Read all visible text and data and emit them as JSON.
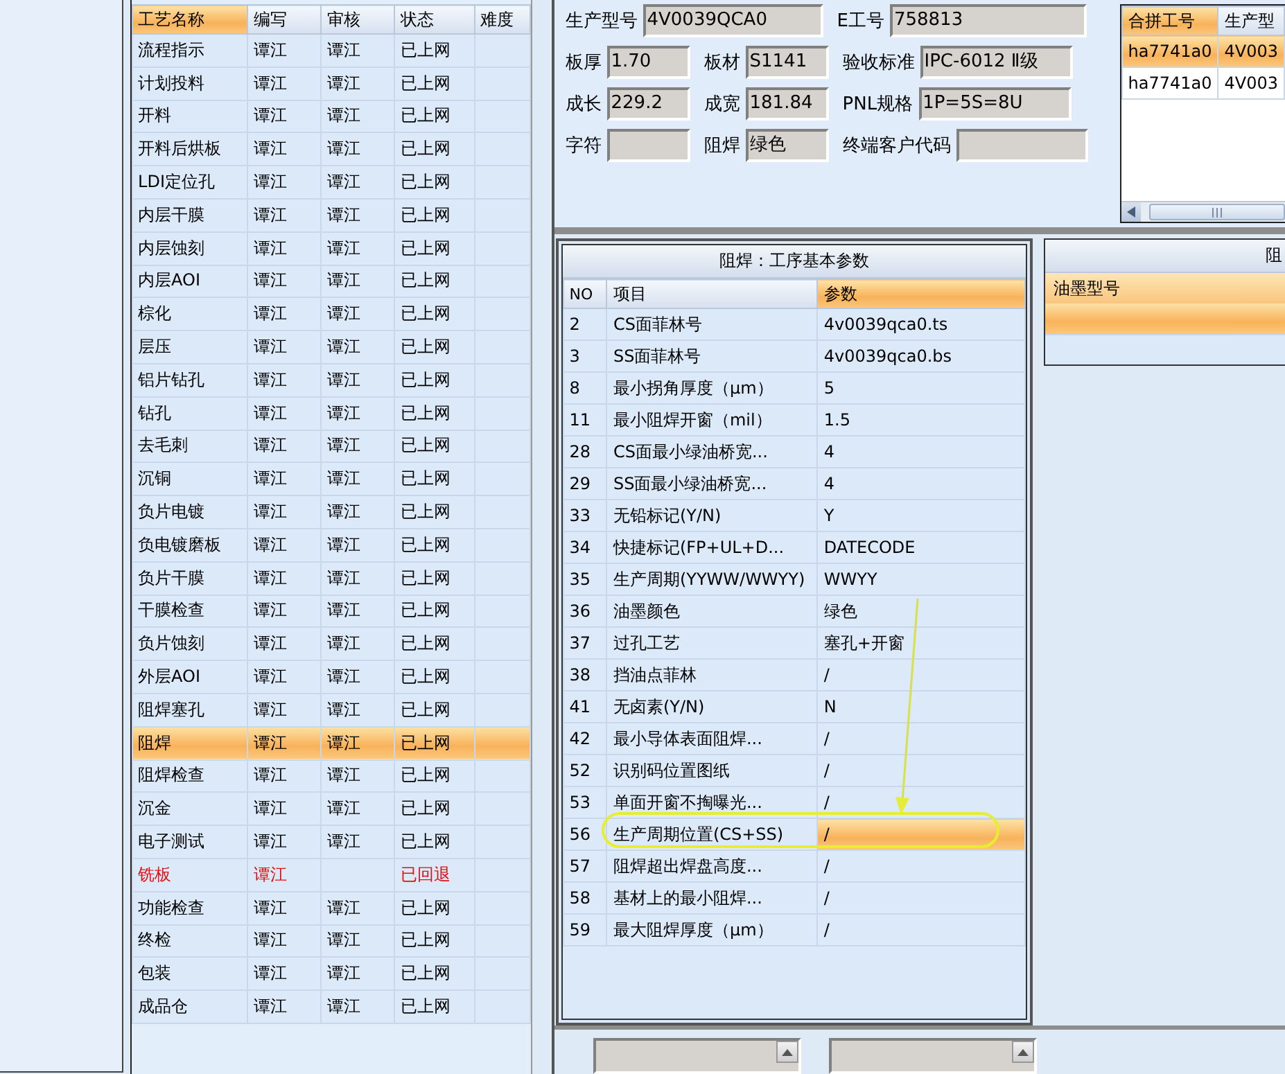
{
  "process_table": {
    "columns": [
      {
        "label": "工艺名称",
        "sorted": true
      },
      {
        "label": "编写",
        "sorted": false
      },
      {
        "label": "审核",
        "sorted": false
      },
      {
        "label": "状态",
        "sorted": false
      },
      {
        "label": "难度",
        "sorted": false
      }
    ],
    "rows": [
      {
        "name": "流程指示",
        "author": "谭江",
        "reviewer": "谭江",
        "status": "已上网",
        "kind": "online",
        "selected": false
      },
      {
        "name": "计划投料",
        "author": "谭江",
        "reviewer": "谭江",
        "status": "已上网",
        "kind": "online",
        "selected": false
      },
      {
        "name": "开料",
        "author": "谭江",
        "reviewer": "谭江",
        "status": "已上网",
        "kind": "online",
        "selected": false
      },
      {
        "name": "开料后烘板",
        "author": "谭江",
        "reviewer": "谭江",
        "status": "已上网",
        "kind": "online",
        "selected": false
      },
      {
        "name": "LDI定位孔",
        "author": "谭江",
        "reviewer": "谭江",
        "status": "已上网",
        "kind": "online",
        "selected": false
      },
      {
        "name": "内层干膜",
        "author": "谭江",
        "reviewer": "谭江",
        "status": "已上网",
        "kind": "online",
        "selected": false
      },
      {
        "name": "内层蚀刻",
        "author": "谭江",
        "reviewer": "谭江",
        "status": "已上网",
        "kind": "online",
        "selected": false
      },
      {
        "name": "内层AOI",
        "author": "谭江",
        "reviewer": "谭江",
        "status": "已上网",
        "kind": "online",
        "selected": false
      },
      {
        "name": "棕化",
        "author": "谭江",
        "reviewer": "谭江",
        "status": "已上网",
        "kind": "online",
        "selected": false
      },
      {
        "name": "层压",
        "author": "谭江",
        "reviewer": "谭江",
        "status": "已上网",
        "kind": "online",
        "selected": false
      },
      {
        "name": "铝片钻孔",
        "author": "谭江",
        "reviewer": "谭江",
        "status": "已上网",
        "kind": "online",
        "selected": false
      },
      {
        "name": "钻孔",
        "author": "谭江",
        "reviewer": "谭江",
        "status": "已上网",
        "kind": "online",
        "selected": false
      },
      {
        "name": "去毛刺",
        "author": "谭江",
        "reviewer": "谭江",
        "status": "已上网",
        "kind": "online",
        "selected": false
      },
      {
        "name": "沉铜",
        "author": "谭江",
        "reviewer": "谭江",
        "status": "已上网",
        "kind": "online",
        "selected": false
      },
      {
        "name": "负片电镀",
        "author": "谭江",
        "reviewer": "谭江",
        "status": "已上网",
        "kind": "online",
        "selected": false
      },
      {
        "name": "负电镀磨板",
        "author": "谭江",
        "reviewer": "谭江",
        "status": "已上网",
        "kind": "online",
        "selected": false
      },
      {
        "name": "负片干膜",
        "author": "谭江",
        "reviewer": "谭江",
        "status": "已上网",
        "kind": "online",
        "selected": false
      },
      {
        "name": "干膜检查",
        "author": "谭江",
        "reviewer": "谭江",
        "status": "已上网",
        "kind": "online",
        "selected": false
      },
      {
        "name": "负片蚀刻",
        "author": "谭江",
        "reviewer": "谭江",
        "status": "已上网",
        "kind": "online",
        "selected": false
      },
      {
        "name": "外层AOI",
        "author": "谭江",
        "reviewer": "谭江",
        "status": "已上网",
        "kind": "online",
        "selected": false
      },
      {
        "name": "阻焊塞孔",
        "author": "谭江",
        "reviewer": "谭江",
        "status": "已上网",
        "kind": "online",
        "selected": false
      },
      {
        "name": "阻焊",
        "author": "谭江",
        "reviewer": "谭江",
        "status": "已上网",
        "kind": "online",
        "selected": true
      },
      {
        "name": "阻焊检查",
        "author": "谭江",
        "reviewer": "谭江",
        "status": "已上网",
        "kind": "online",
        "selected": false
      },
      {
        "name": "沉金",
        "author": "谭江",
        "reviewer": "谭江",
        "status": "已上网",
        "kind": "online",
        "selected": false
      },
      {
        "name": "电子测试",
        "author": "谭江",
        "reviewer": "谭江",
        "status": "已上网",
        "kind": "online",
        "selected": false
      },
      {
        "name": "铣板",
        "author": "谭江",
        "status": "已回退",
        "kind": "returned",
        "selected": false
      },
      {
        "name": "功能检查",
        "author": "谭江",
        "reviewer": "谭江",
        "status": "已上网",
        "kind": "online",
        "selected": false
      },
      {
        "name": "终检",
        "author": "谭江",
        "reviewer": "谭江",
        "status": "已上网",
        "kind": "online",
        "selected": false
      },
      {
        "name": "包装",
        "author": "谭江",
        "reviewer": "谭江",
        "status": "已上网",
        "kind": "online",
        "selected": false
      },
      {
        "name": "成品仓",
        "author": "谭江",
        "reviewer": "谭江",
        "status": "已上网",
        "kind": "online",
        "selected": false
      }
    ]
  },
  "form": [
    [
      {
        "label": "生产型号",
        "value": "4V0039QCA0"
      },
      {
        "label": "E工号",
        "value": "758813"
      }
    ],
    [
      {
        "label": "板厚",
        "value": "1.70"
      },
      {
        "label": "板材",
        "value": "S1141"
      },
      {
        "label": "验收标准",
        "value": "IPC-6012 Ⅱ级"
      }
    ],
    [
      {
        "label": "成长",
        "value": "229.2"
      },
      {
        "label": "成宽",
        "value": "181.84"
      },
      {
        "label": "PNL规格",
        "value": "1P=5S=8U"
      }
    ],
    [
      {
        "label": "字符"
      },
      {
        "label": "阻焊",
        "value": "绿色"
      },
      {
        "label": "终端客户代码"
      }
    ]
  ],
  "merge_table": {
    "columns": [
      {
        "label": "合拼工号",
        "sorted": true
      },
      {
        "label": "生产型",
        "sorted": false
      }
    ],
    "rows": [
      {
        "cells": [
          "ha7741a0",
          "4V003"
        ],
        "selected": true
      },
      {
        "cells": [
          "ha7741a0",
          "4V003"
        ],
        "selected": false
      }
    ]
  },
  "params": {
    "title": "阻焊：工序基本参数",
    "columns": [
      {
        "label": "NO",
        "sorted": false
      },
      {
        "label": "项目",
        "sorted": false
      },
      {
        "label": "参数",
        "sorted": true
      }
    ],
    "rows": [
      {
        "no": "2",
        "item": "CS面菲林号",
        "value": "4v0039qca0.ts",
        "selected": false
      },
      {
        "no": "3",
        "item": "SS面菲林号",
        "value": "4v0039qca0.bs",
        "selected": false
      },
      {
        "no": "8",
        "item": "最小拐角厚度（μm）",
        "value": "5",
        "selected": false
      },
      {
        "no": "11",
        "item": "最小阻焊开窗（mil）",
        "value": "1.5",
        "selected": false
      },
      {
        "no": "28",
        "item": "CS面最小绿油桥宽...",
        "value": "4",
        "selected": false
      },
      {
        "no": "29",
        "item": "SS面最小绿油桥宽...",
        "value": "4",
        "selected": false
      },
      {
        "no": "33",
        "item": "无铅标记(Y/N)",
        "value": "Y",
        "selected": false
      },
      {
        "no": "34",
        "item": "快捷标记(FP+UL+D...",
        "value": "DATECODE",
        "selected": false
      },
      {
        "no": "35",
        "item": "生产周期(YYWW/WWYY)",
        "value": "WWYY",
        "selected": false
      },
      {
        "no": "36",
        "item": "油墨颜色",
        "value": "绿色",
        "selected": false
      },
      {
        "no": "37",
        "item": "过孔工艺",
        "value": "塞孔+开窗",
        "selected": false
      },
      {
        "no": "38",
        "item": "挡油点菲林",
        "value": "/",
        "selected": false
      },
      {
        "no": "41",
        "item": "无卤素(Y/N)",
        "value": "N",
        "selected": false
      },
      {
        "no": "42",
        "item": "最小导体表面阻焊...",
        "value": "/",
        "selected": false
      },
      {
        "no": "52",
        "item": "识别码位置图纸",
        "value": "/",
        "selected": false
      },
      {
        "no": "53",
        "item": "单面开窗不掏曝光...",
        "value": "/",
        "selected": false
      },
      {
        "no": "56",
        "item": "生产周期位置(CS+SS)",
        "value": "/",
        "selected": true
      },
      {
        "no": "57",
        "item": "阻焊超出焊盘高度...",
        "value": "/",
        "selected": false
      },
      {
        "no": "58",
        "item": "基材上的最小阻焊...",
        "value": "/",
        "selected": false
      },
      {
        "no": "59",
        "item": "最大阻焊厚度（μm）",
        "value": "/",
        "selected": false
      }
    ]
  },
  "ink": {
    "title": "阻",
    "column": "油墨型号",
    "rows": [
      {
        "selected": true
      }
    ]
  }
}
